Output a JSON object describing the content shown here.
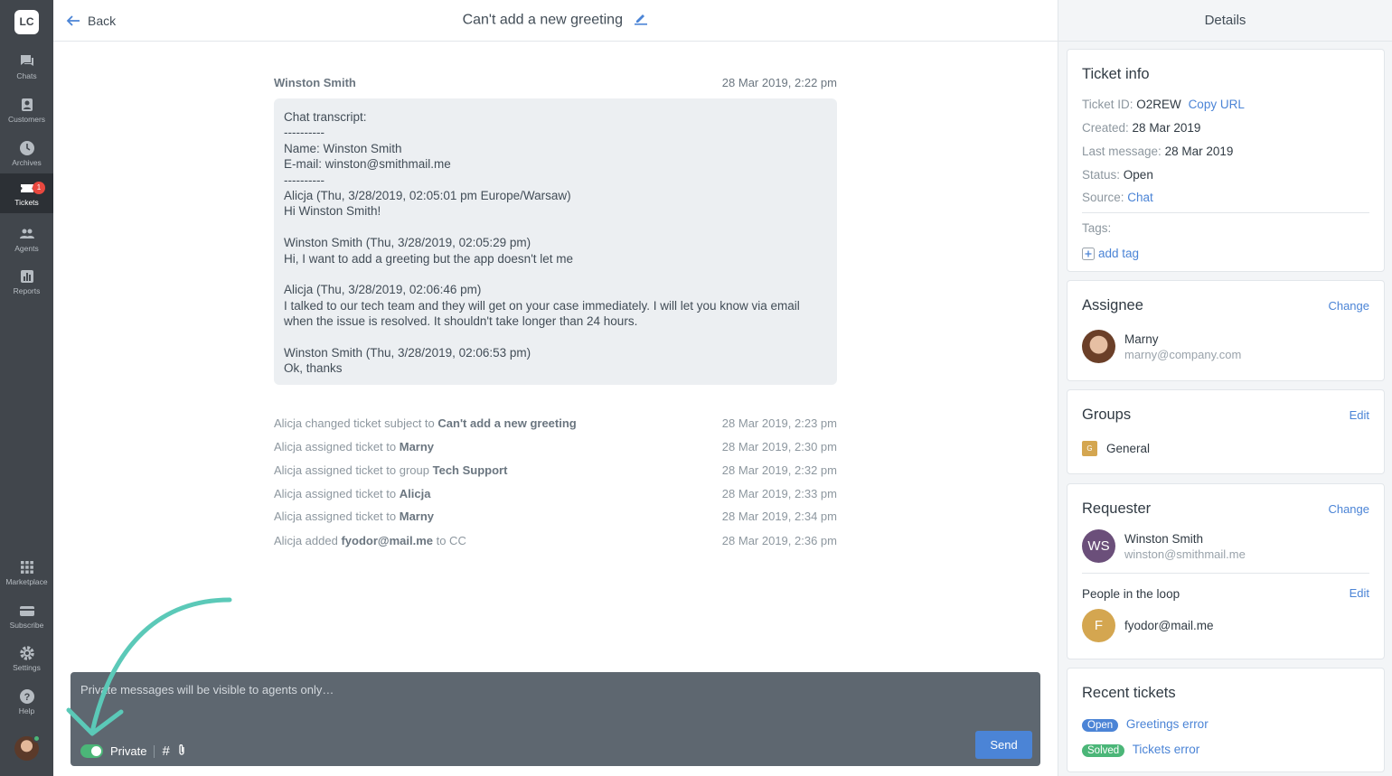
{
  "nav": {
    "logo": "LC",
    "items": [
      {
        "label": "Chats",
        "icon": "chat-icon"
      },
      {
        "label": "Customers",
        "icon": "customers-icon"
      },
      {
        "label": "Archives",
        "icon": "clock-icon"
      },
      {
        "label": "Tickets",
        "icon": "ticket-icon",
        "badge": "1",
        "active": true
      },
      {
        "label": "Agents",
        "icon": "agents-icon"
      },
      {
        "label": "Reports",
        "icon": "reports-icon"
      },
      {
        "label": "Marketplace",
        "icon": "grid-icon"
      },
      {
        "label": "Subscribe",
        "icon": "card-icon"
      },
      {
        "label": "Settings",
        "icon": "gear-icon"
      },
      {
        "label": "Help",
        "icon": "help-icon"
      }
    ]
  },
  "header": {
    "back_label": "Back",
    "title": "Can't add a new greeting"
  },
  "message": {
    "author": "Winston Smith",
    "time": "28 Mar 2019, 2:22 pm",
    "lines": [
      "Chat transcript:",
      "----------",
      "Name: Winston Smith",
      "E-mail: winston@smithmail.me",
      "----------",
      "Alicja (Thu, 3/28/2019, 02:05:01 pm Europe/Warsaw)",
      "Hi Winston Smith!",
      "",
      "Winston Smith (Thu, 3/28/2019, 02:05:29 pm)",
      "Hi, I want to add a greeting but the app doesn't let me",
      "",
      "Alicja (Thu, 3/28/2019, 02:06:46 pm)",
      "I talked to our tech team and they will get on your case immediately. I will let you know via email",
      "when the issue is resolved. It shouldn't take longer than 24 hours.",
      "",
      "Winston Smith (Thu, 3/28/2019, 02:06:53 pm)",
      "Ok, thanks"
    ]
  },
  "events": [
    {
      "pre": "Alicja changed ticket subject to ",
      "bold": "Can't add a new greeting",
      "post": "",
      "time": "28 Mar 2019, 2:23 pm"
    },
    {
      "pre": "Alicja assigned ticket to ",
      "bold": "Marny",
      "post": "",
      "time": "28 Mar 2019, 2:30 pm"
    },
    {
      "pre": "Alicja assigned ticket to group ",
      "bold": "Tech Support",
      "post": "",
      "time": "28 Mar 2019, 2:32 pm"
    },
    {
      "pre": "Alicja assigned ticket to ",
      "bold": "Alicja",
      "post": "",
      "time": "28 Mar 2019, 2:33 pm"
    },
    {
      "pre": "Alicja assigned ticket to ",
      "bold": "Marny",
      "post": "",
      "time": "28 Mar 2019, 2:34 pm"
    },
    {
      "pre": "Alicja added ",
      "bold": "fyodor@mail.me",
      "post": " to CC",
      "time": "28 Mar 2019, 2:36 pm"
    }
  ],
  "composer": {
    "placeholder": "Private messages will be visible to agents only…",
    "private_label": "Private",
    "hash": "#",
    "send_label": "Send",
    "private_on": true
  },
  "details": {
    "title": "Details",
    "ticket_info": {
      "heading": "Ticket info",
      "id_label": "Ticket ID:",
      "id": "O2REW",
      "copy_url": "Copy URL",
      "created_label": "Created:",
      "created": "28 Mar 2019",
      "last_label": "Last message:",
      "last": "28 Mar 2019",
      "status_label": "Status:",
      "status": "Open",
      "source_label": "Source:",
      "source": "Chat",
      "tags_label": "Tags:",
      "add_tag": "add tag"
    },
    "assignee": {
      "heading": "Assignee",
      "action": "Change",
      "name": "Marny",
      "email": "marny@company.com"
    },
    "groups": {
      "heading": "Groups",
      "action": "Edit",
      "badge": "G",
      "name": "General"
    },
    "requester": {
      "heading": "Requester",
      "action": "Change",
      "initials": "WS",
      "name": "Winston Smith",
      "email": "winston@smithmail.me",
      "loop_heading": "People in the loop",
      "loop_action": "Edit",
      "loop_initial": "F",
      "loop_email": "fyodor@mail.me"
    },
    "recent": {
      "heading": "Recent tickets",
      "items": [
        {
          "status": "Open",
          "status_color": "#4b84d6",
          "title": "Greetings error"
        },
        {
          "status": "Solved",
          "status_color": "#4bb678",
          "title": "Tickets error"
        }
      ]
    }
  },
  "colors": {
    "accent": "#4b84d6",
    "success": "#4bb678",
    "nav_bg": "#41464c",
    "arrow": "#5bc9b8"
  }
}
